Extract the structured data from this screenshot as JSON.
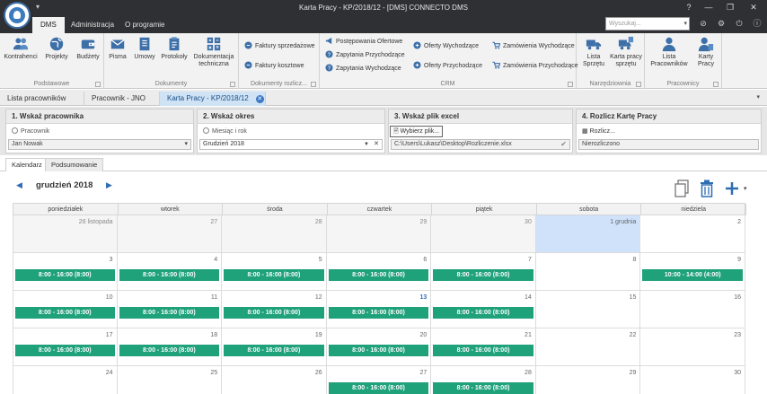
{
  "window": {
    "title": "Karta Pracy - KP/2018/12 - [DMS] CONNECTO DMS"
  },
  "ribbon_tabs": [
    {
      "label": "DMS",
      "active": true
    },
    {
      "label": "Administracja",
      "active": false
    },
    {
      "label": "O programie",
      "active": false
    }
  ],
  "search": {
    "placeholder": "Wyszukaj..."
  },
  "groups": {
    "podstawowe": {
      "label": "Podstawowe",
      "buttons": [
        {
          "label": "Kontrahenci",
          "icon": "contacts-icon"
        },
        {
          "label": "Projekty",
          "icon": "globe-icon"
        },
        {
          "label": "Budżety",
          "icon": "wallet-icon"
        }
      ]
    },
    "dokumenty": {
      "label": "Dokumenty",
      "buttons": [
        {
          "label": "Pisma",
          "icon": "envelope-icon"
        },
        {
          "label": "Umowy",
          "icon": "contract-icon"
        },
        {
          "label": "Protokoły",
          "icon": "clipboard-icon"
        },
        {
          "label": "Dokumentacja techniczna",
          "icon": "calculator-icon"
        }
      ]
    },
    "rozliczenia": {
      "label": "Dokumenty rozlicz...",
      "items": [
        "Faktury sprzedażowe",
        "Faktury kosztowe"
      ]
    },
    "crm": {
      "label": "CRM",
      "col1": [
        "Postępowania Ofertowe",
        "Zapytania Przychodzące",
        "Zapytania Wychodzące"
      ],
      "col2": [
        "Oferty Wychodzące",
        "Oferty Przychodzące"
      ],
      "col3": [
        "Zamówienia Wychodzące",
        "Zamówienia Przychodzące"
      ]
    },
    "narzedziownia": {
      "label": "Narzędziownia",
      "buttons": [
        {
          "label": "Lista Sprzętu",
          "icon": "truck-icon"
        },
        {
          "label": "Karta pracy sprzętu",
          "icon": "truck-card-icon"
        }
      ]
    },
    "pracownicy": {
      "label": "Pracownicy",
      "buttons": [
        {
          "label": "Lista Pracowników",
          "icon": "person-icon"
        },
        {
          "label": "Karty Pracy",
          "icon": "person-card-icon"
        }
      ]
    }
  },
  "doc_tabs": [
    {
      "label": "Lista pracowników",
      "active": false
    },
    {
      "label": "Pracownik - JNO",
      "active": false
    },
    {
      "label": "Karta Pracy - KP/2018/12",
      "active": true
    }
  ],
  "steps": [
    {
      "title": "1. Wskaż pracownika",
      "sub": "Pracownik",
      "value": "Jan Nowak"
    },
    {
      "title": "2. Wskaż okres",
      "sub": "Miesiąc i rok",
      "value": "Grudzień 2018"
    },
    {
      "title": "3. Wskaż plik excel",
      "button": "Wybierz plik...",
      "value": "C:\\Users\\Lukasz\\Desktop\\Rozliczenie.xlsx"
    },
    {
      "title": "4. Rozlicz Kartę Pracy",
      "button": "Rozlicz...",
      "value": "Nierozliczono"
    }
  ],
  "sub_tabs": [
    {
      "label": "Kalendarz",
      "active": true
    },
    {
      "label": "Podsumowanie",
      "active": false
    }
  ],
  "calendar": {
    "month_label": "grudzień 2018",
    "weekdays": [
      "poniedziałek",
      "wtorek",
      "środa",
      "czwartek",
      "piątek",
      "sobota",
      "niedziela"
    ],
    "weeks": [
      [
        {
          "day": "26 listopada",
          "other": true
        },
        {
          "day": "27",
          "other": true
        },
        {
          "day": "28",
          "other": true
        },
        {
          "day": "29",
          "other": true
        },
        {
          "day": "30",
          "other": true
        },
        {
          "day": "1 grudnia",
          "today": true
        },
        {
          "day": "2"
        }
      ],
      [
        {
          "day": "3",
          "event": "8:00 - 16:00 (8:00)"
        },
        {
          "day": "4",
          "event": "8:00 - 16:00 (8:00)"
        },
        {
          "day": "5",
          "event": "8:00 - 16:00 (8:00)"
        },
        {
          "day": "6",
          "event": "8:00 - 16:00 (8:00)"
        },
        {
          "day": "7",
          "event": "8:00 - 16:00 (8:00)"
        },
        {
          "day": "8"
        },
        {
          "day": "9",
          "event": "10:00 - 14:00 (4:00)"
        }
      ],
      [
        {
          "day": "10",
          "event": "8:00 - 16:00 (8:00)"
        },
        {
          "day": "11",
          "event": "8:00 - 16:00 (8:00)"
        },
        {
          "day": "12",
          "event": "8:00 - 16:00 (8:00)"
        },
        {
          "day": "13",
          "event": "8:00 - 16:00 (8:00)",
          "highlight": true
        },
        {
          "day": "14",
          "event": "8:00 - 16:00 (8:00)"
        },
        {
          "day": "15"
        },
        {
          "day": "16"
        }
      ],
      [
        {
          "day": "17",
          "event": "8:00 - 16:00 (8:00)"
        },
        {
          "day": "18",
          "event": "8:00 - 16:00 (8:00)"
        },
        {
          "day": "19",
          "event": "8:00 - 16:00 (8:00)"
        },
        {
          "day": "20",
          "event": "8:00 - 16:00 (8:00)"
        },
        {
          "day": "21",
          "event": "8:00 - 16:00 (8:00)"
        },
        {
          "day": "22"
        },
        {
          "day": "23"
        }
      ],
      [
        {
          "day": "24"
        },
        {
          "day": "25"
        },
        {
          "day": "26"
        },
        {
          "day": "27",
          "event": "8:00 - 16:00 (8:00)"
        },
        {
          "day": "28",
          "event": "8:00 - 16:00 (8:00)"
        },
        {
          "day": "29"
        },
        {
          "day": "30"
        }
      ]
    ]
  },
  "colors": {
    "event": "#1fa17a",
    "today": "#cfe2fa",
    "titlebar": "#2f3034",
    "accent": "#3b78c4"
  }
}
